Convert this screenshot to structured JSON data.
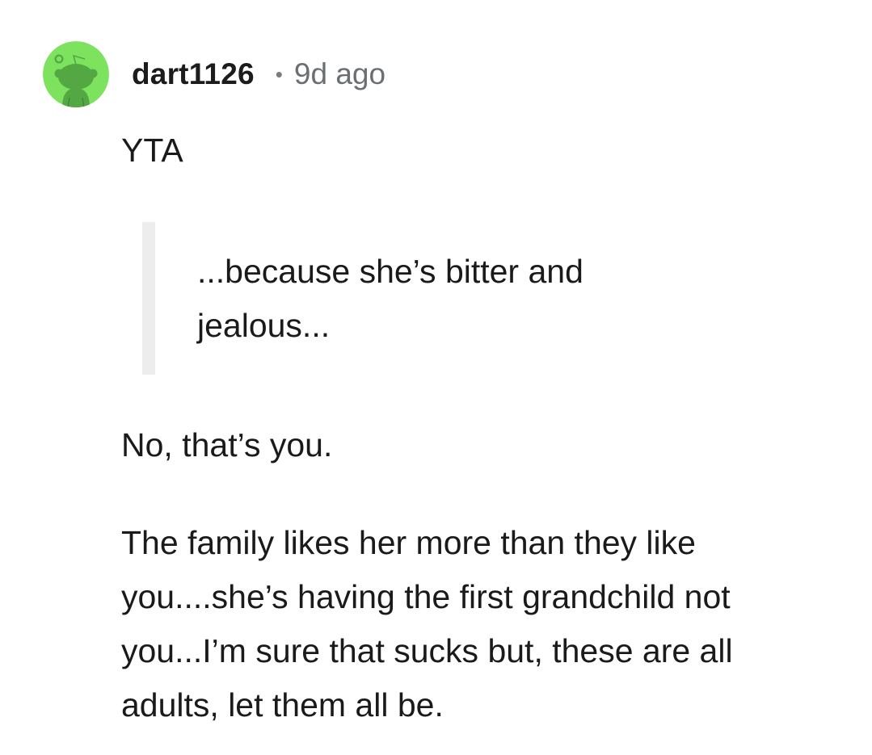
{
  "comment": {
    "avatar_icon": "reddit-snoo-avatar-icon",
    "avatar_color": "#7de35f",
    "username": "dart1126",
    "separator": "•",
    "time_ago": "9d ago",
    "verdict": "YTA",
    "quote_lines": [
      "...because she’s bitter and",
      "jealous..."
    ],
    "reply_line": "No, that’s you.",
    "paragraph_lines": [
      "The family likes her more than they like",
      "you....she’s having the first grandchild not",
      "you...I’m sure that sucks but, these are all",
      "adults, let them all be."
    ]
  }
}
